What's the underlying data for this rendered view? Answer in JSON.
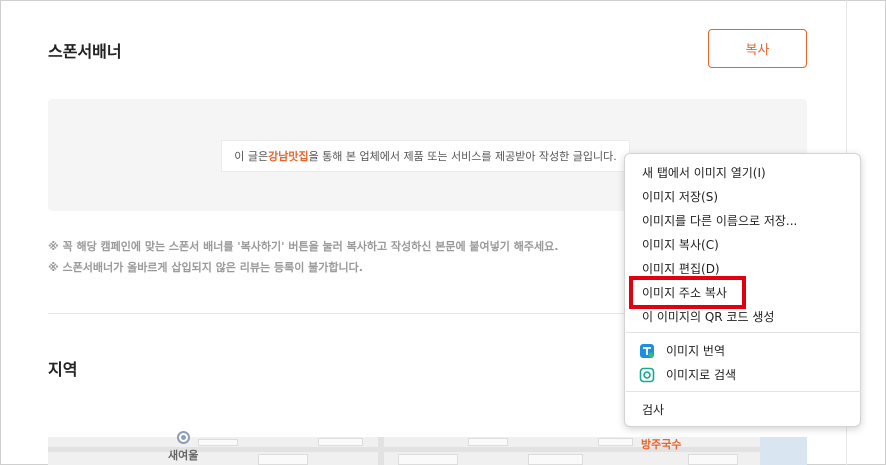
{
  "sponsor": {
    "title": "스폰서배너",
    "copy_button": "복사",
    "banner_prefix": "이 글은 ",
    "banner_brand": "강남맛집",
    "banner_suffix": "을 통해 본 업체에서 제품 또는 서비스를 제공받아 작성한 글입니다.",
    "notes": [
      "※ 꼭 해당 캠페인에 맞는 스폰서 배너를 '복사하기' 버튼을 눌러 복사하고 작성하신 본문에 붙여넣기 해주세요.",
      "※ 스폰서배너가 올바르게 삽입되지 않은 리뷰는 등록이 불가합니다."
    ]
  },
  "region": {
    "title": "지역",
    "map_labels": [
      "새여울",
      "방주국수"
    ]
  },
  "context_menu": {
    "items": [
      {
        "label": "새 탭에서 이미지 열기(I)"
      },
      {
        "label": "이미지 저장(S)"
      },
      {
        "label": "이미지를 다른 이름으로 저장..."
      },
      {
        "label": "이미지 복사(C)"
      },
      {
        "label": "이미지 편집(D)"
      },
      {
        "label": "이미지 주소 복사"
      },
      {
        "label": "이 이미지의 QR 코드 생성"
      },
      {
        "label": "이미지 번역",
        "icon": "translate-icon"
      },
      {
        "label": "이미지로 검색",
        "icon": "visual-search-icon"
      },
      {
        "label": "검사"
      }
    ]
  },
  "colors": {
    "accent": "#e8642c",
    "highlight": "#e0000f"
  }
}
